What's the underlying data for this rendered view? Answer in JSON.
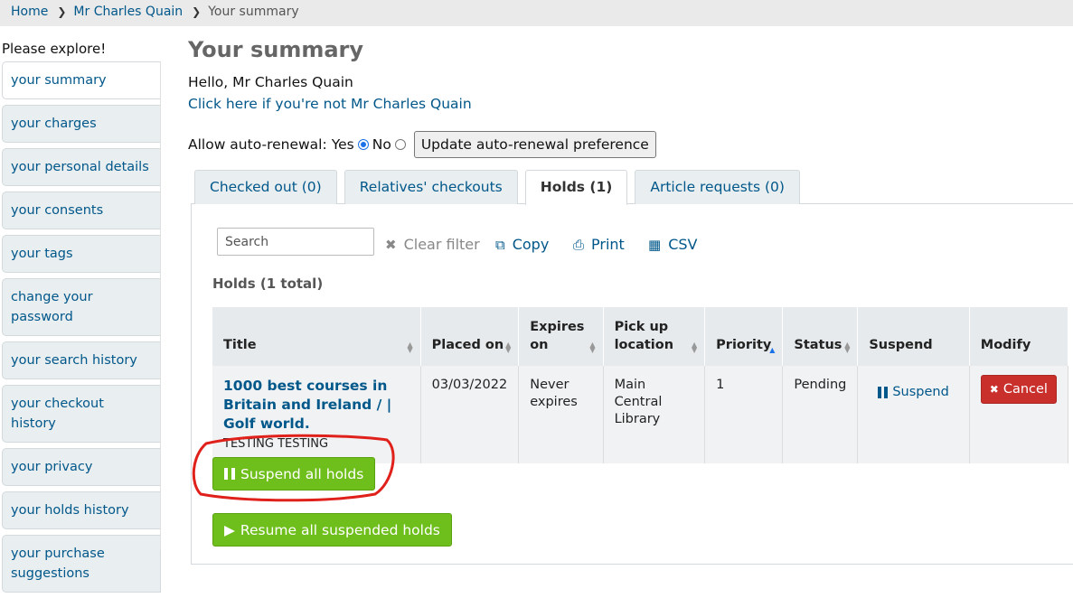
{
  "breadcrumb": {
    "home": "Home",
    "patron": "Mr Charles Quain",
    "current": "Your summary"
  },
  "sidebar": {
    "heading": "Please explore!",
    "items": [
      {
        "label": "your summary"
      },
      {
        "label": "your charges"
      },
      {
        "label": "your personal details"
      },
      {
        "label": "your consents"
      },
      {
        "label": "your tags"
      },
      {
        "label": "change your password"
      },
      {
        "label": "your search history"
      },
      {
        "label": "your checkout history"
      },
      {
        "label": "your privacy"
      },
      {
        "label": "your holds history"
      },
      {
        "label": "your purchase suggestions"
      }
    ]
  },
  "main": {
    "title": "Your summary",
    "greeting": "Hello, Mr Charles Quain",
    "not_me_link": "Click here if you're not Mr Charles Quain",
    "auto_renewal": {
      "label": "Allow auto-renewal:",
      "yes": "Yes",
      "no": "No",
      "selected": "Yes",
      "button": "Update auto-renewal preference"
    },
    "tabs": [
      {
        "label": "Checked out (0)"
      },
      {
        "label": "Relatives' checkouts"
      },
      {
        "label": "Holds (1)"
      },
      {
        "label": "Article requests (0)"
      }
    ],
    "active_tab": "Holds (1)",
    "toolbar": {
      "search_placeholder": "Search",
      "clear": "Clear filter",
      "copy": "Copy",
      "print": "Print",
      "csv": "CSV"
    },
    "holds_total": "Holds (1 total)",
    "table": {
      "headers": {
        "title": "Title",
        "placed_on": "Placed on",
        "expires_on": "Expires on",
        "pickup": "Pick up location",
        "priority": "Priority",
        "status": "Status",
        "suspend": "Suspend",
        "modify": "Modify"
      },
      "rows": [
        {
          "title": "1000 best courses in Britain and Ireland / | Golf world.",
          "author": "TESTING TESTING",
          "placed_on": "03/03/2022",
          "expires_on": "Never expires",
          "pickup": "Main Central Library",
          "priority": "1",
          "status": "Pending",
          "suspend": "Suspend",
          "modify": "Cancel"
        }
      ]
    },
    "suspend_all": "Suspend all holds",
    "resume_all": "Resume all suspended holds"
  },
  "colors": {
    "link": "#00578a",
    "green_button": "#6fbf1c",
    "cancel_button": "#c9302c",
    "annotation": "#e0201a"
  }
}
